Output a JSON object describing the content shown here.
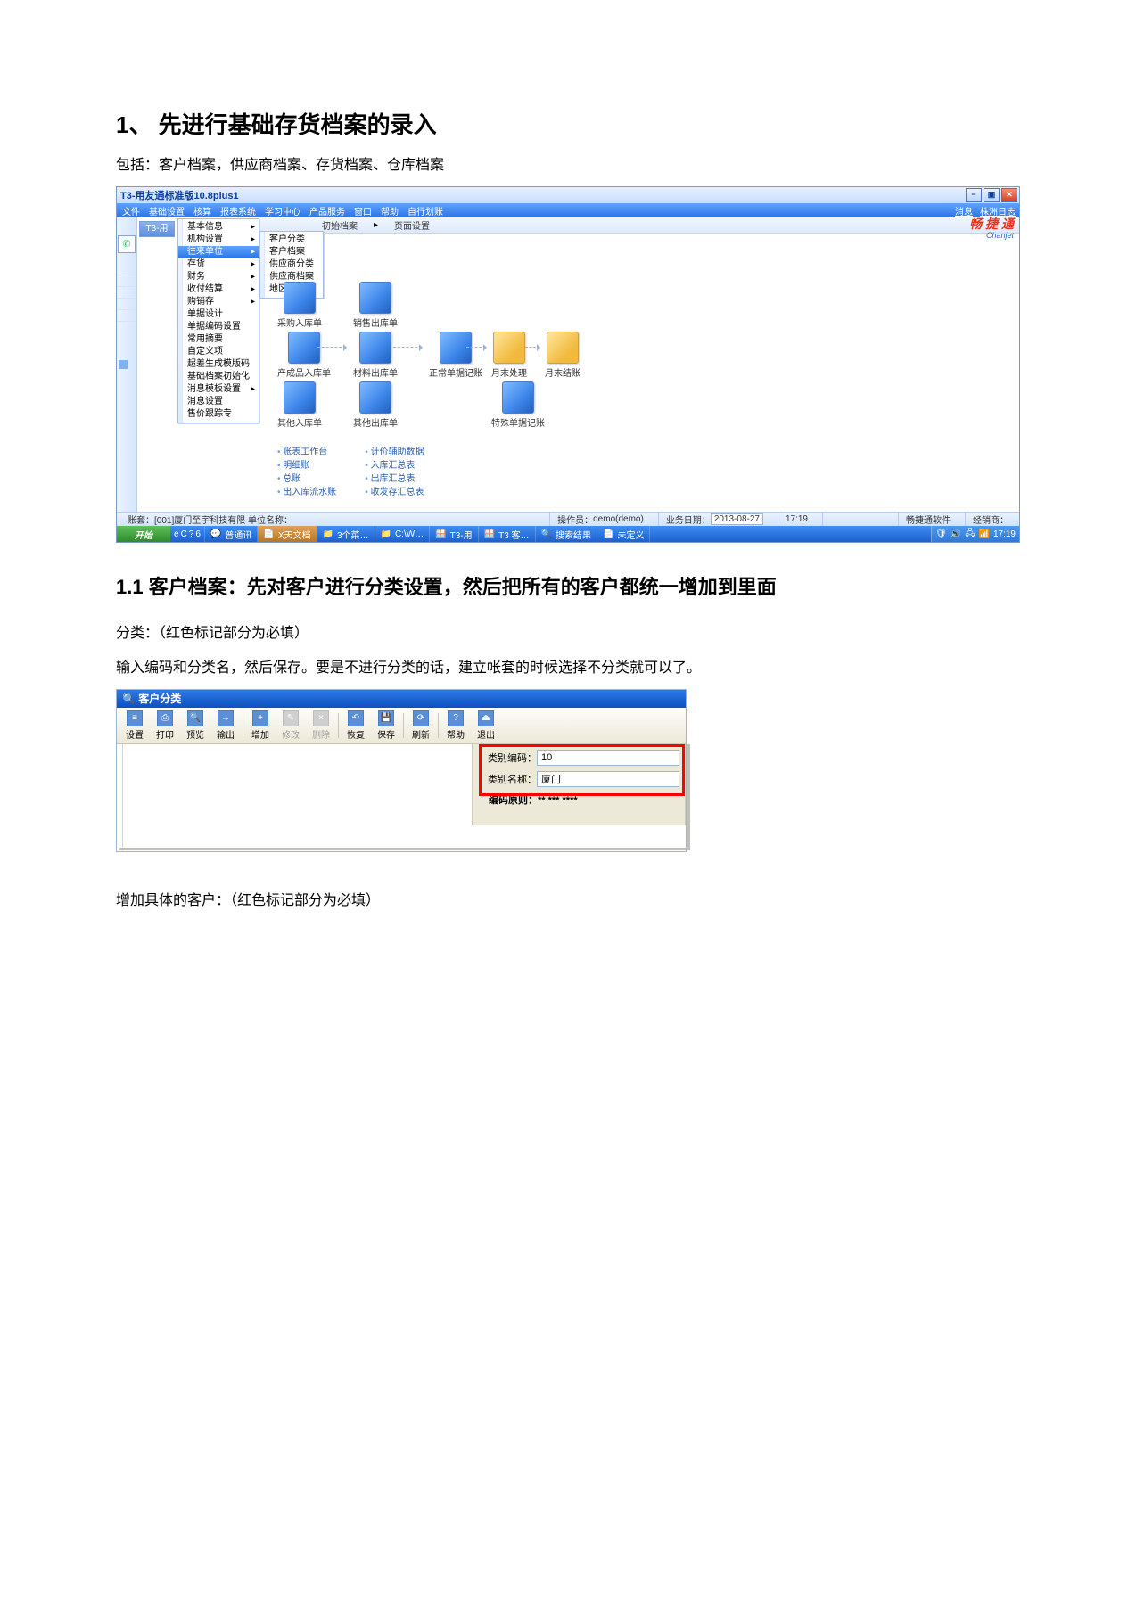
{
  "doc": {
    "h1": "1、  先进行基础存货档案的录入",
    "p1": "包括：客户档案，供应商档案、存货档案、仓库档案",
    "h2": "1.1 客户档案：先对客户进行分类设置，然后把所有的客户都统一增加到里面",
    "p2": "分类：（红色标记部分为必填）",
    "p3": "输入编码和分类名，然后保存。要是不进行分类的话，建立帐套的时候选择不分类就可以了。",
    "p4": "增加具体的客户：（红色标记部分为必填）"
  },
  "ss1": {
    "title": "T3-用友通标准版10.8plus1",
    "menus": [
      "文件",
      "基础设置",
      "核算",
      "报表系统",
      "学习中心",
      "产品服务",
      "窗口",
      "帮助",
      "自行划账"
    ],
    "topright": [
      "消息",
      "株洲日志"
    ],
    "brand": {
      "cn": "畅 捷 通",
      "en": "Chanjet"
    },
    "pill": "T3-用",
    "toolbar_items": [
      "初始档案",
      "页面设置"
    ],
    "popup1": [
      "基本信息",
      "机构设置",
      "往来单位",
      "存货",
      "财务",
      "收付结算",
      "购销存",
      "单据设计",
      "单据编码设置",
      "常用摘要",
      "自定义项",
      "超差生成模版码",
      "基础档案初始化",
      "消息模板设置",
      "消息设置",
      "售价跟踪专"
    ],
    "popup1_active": "往来单位",
    "popup2": [
      "客户分类",
      "客户档案",
      "供应商分类",
      "供应商档案",
      "地区分类"
    ],
    "wf": {
      "a1": "采购入库单",
      "a2": "销售出库单",
      "b1": "产成品入库单",
      "b2": "材料出库单",
      "b3": "正常单据记账",
      "b4": "月末处理",
      "b5": "月末结账",
      "c1": "其他入库单",
      "c2": "其他出库单",
      "c3": "特殊单据记账"
    },
    "links_left": [
      "账表工作台",
      "明细账",
      "总账",
      "出入库流水账"
    ],
    "links_right": [
      "计价辅助数据",
      "入库汇总表",
      "出库汇总表",
      "收发存汇总表"
    ],
    "status": {
      "left": "账套：[001]厦门至宇科技有限   单位名称：",
      "operator_label": "操作员：",
      "operator": "demo(demo)",
      "date_label": "业务日期：",
      "date": "2013-08-27",
      "time": "17:19",
      "prod": "畅捷通软件",
      "reg": "经销商："
    },
    "taskbar": {
      "start": "开始",
      "ql": [
        "e",
        "C",
        "?",
        "6"
      ],
      "items": [
        "普通讯",
        "X天文档",
        "3个菜…",
        "C:\\W…",
        "T3-用",
        "T3 客…",
        "搜索结果",
        "未定义"
      ],
      "tray_time": "17:19"
    }
  },
  "ss2": {
    "title_icon": "🔍",
    "title": "客户分类",
    "buttons": [
      {
        "label": "设置",
        "ic": "≡",
        "dis": false
      },
      {
        "label": "打印",
        "ic": "⎙",
        "dis": false
      },
      {
        "label": "预览",
        "ic": "🔍",
        "dis": false
      },
      {
        "label": "输出",
        "ic": "→",
        "dis": false
      },
      {
        "sep": true
      },
      {
        "label": "增加",
        "ic": "+",
        "dis": false
      },
      {
        "label": "修改",
        "ic": "✎",
        "dis": true
      },
      {
        "label": "删除",
        "ic": "×",
        "dis": true
      },
      {
        "sep": true
      },
      {
        "label": "恢复",
        "ic": "↶",
        "dis": false
      },
      {
        "label": "保存",
        "ic": "💾",
        "dis": false
      },
      {
        "sep": true
      },
      {
        "label": "刷新",
        "ic": "⟳",
        "dis": false
      },
      {
        "sep": true
      },
      {
        "label": "帮助",
        "ic": "?",
        "dis": false
      },
      {
        "label": "退出",
        "ic": "⏏",
        "dis": false
      }
    ],
    "fields": {
      "code_label": "类别编码：",
      "code_value": "10",
      "name_label": "类别名称：",
      "name_value": "厦门",
      "rule": "编码原则：** *** ****"
    }
  }
}
